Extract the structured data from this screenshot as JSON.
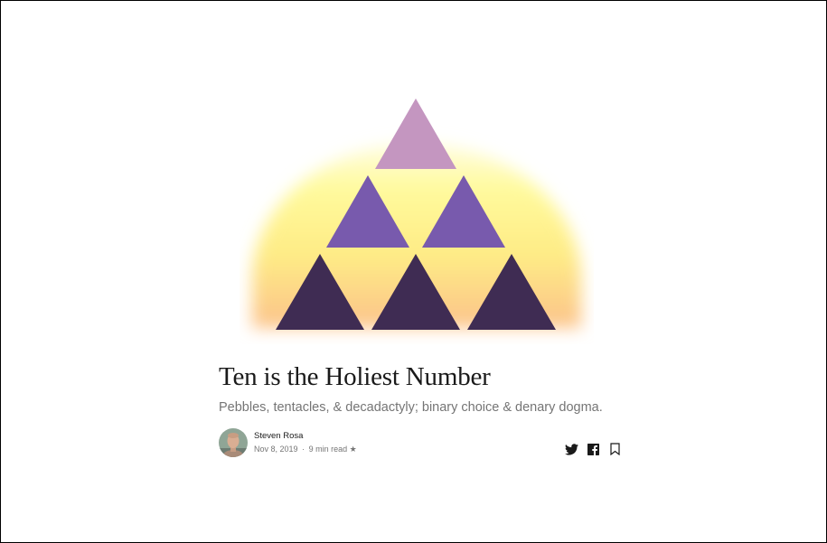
{
  "article": {
    "title": "Ten is the Holiest Number",
    "subtitle": "Pebbles, tentacles, & decadactyly; binary choice & denary dogma.",
    "author": "Steven Rosa",
    "date": "Nov 8, 2019",
    "separator": "·",
    "read_time": "9 min read",
    "member_star": "★"
  },
  "hero": {
    "rows": [
      {
        "count": 1,
        "color": "#c496c0"
      },
      {
        "count": 2,
        "color": "#785aad"
      },
      {
        "count": 3,
        "color": "#3f2c53"
      }
    ],
    "glow_colors": [
      "#fffb9a",
      "#fdcb8a"
    ]
  },
  "actions": [
    {
      "name": "twitter-icon"
    },
    {
      "name": "facebook-icon"
    },
    {
      "name": "bookmark-icon"
    }
  ]
}
